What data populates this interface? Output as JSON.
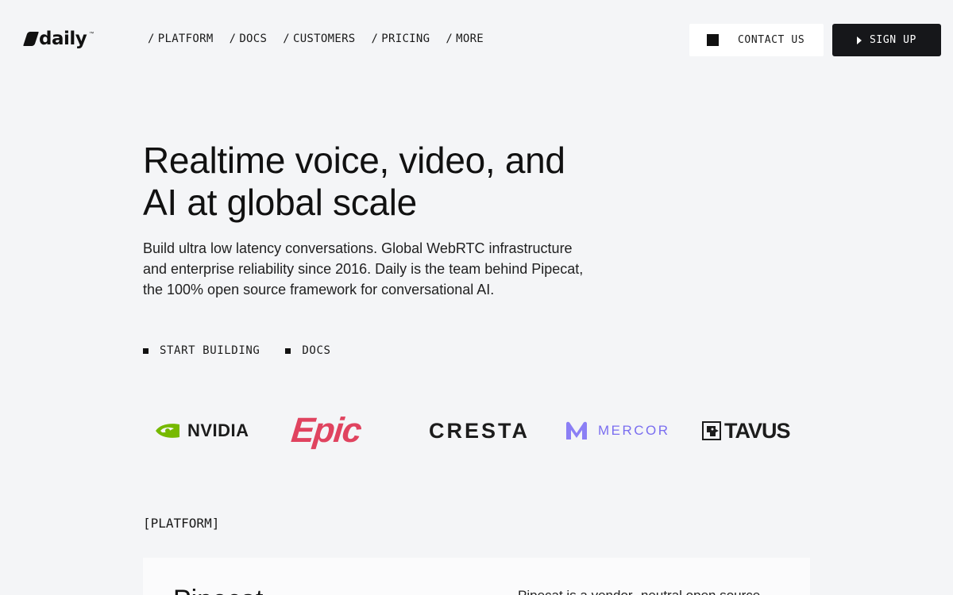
{
  "header": {
    "logo_text": "daily",
    "logo_tm": "™",
    "nav": [
      {
        "label": "PLATFORM"
      },
      {
        "label": "DOCS"
      },
      {
        "label": "CUSTOMERS"
      },
      {
        "label": "PRICING"
      },
      {
        "label": "MORE"
      }
    ],
    "nav_separator": "/",
    "contact_label": "CONTACT US",
    "signup_label": "SIGN UP"
  },
  "hero": {
    "title_line1": "Realtime voice, video, and",
    "title_line2": "AI at global scale",
    "description": "Build ultra low latency conversations. Global WebRTC infrastructure and enterprise reliability since 2016. Daily is the team behind Pipecat, the 100% open source framework for conversational AI.",
    "cta_primary": "START BUILDING",
    "cta_secondary": "DOCS"
  },
  "logos": [
    {
      "name": "NVIDIA",
      "text": "NVIDIA",
      "color": "#76b900"
    },
    {
      "name": "Epic",
      "text": "Epic",
      "color": "#e0435f"
    },
    {
      "name": "CRESTA",
      "text": "CRESTA",
      "color": "#1c1c1c"
    },
    {
      "name": "MERCOR",
      "text": "MERCOR",
      "color": "#7a6ef0"
    },
    {
      "name": "TAVUS",
      "text": "TAVUS",
      "color": "#1c1c1c"
    }
  ],
  "platform": {
    "section_label": "[PLATFORM]",
    "card_title": "Pipecat",
    "card_text": "Pipecat is a vendor- neutral open source"
  },
  "colors": {
    "background": "#f4f5f7",
    "signup_bg": "#16171a",
    "contact_bg": "#ffffff"
  }
}
